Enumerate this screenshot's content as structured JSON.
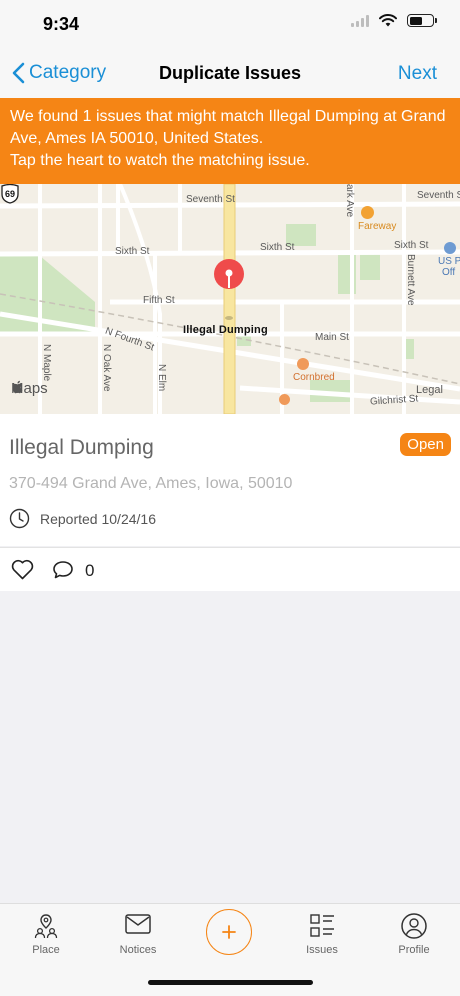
{
  "status_bar": {
    "time": "9:34"
  },
  "nav": {
    "back_label": "Category",
    "title": "Duplicate Issues",
    "next_label": "Next"
  },
  "banner": {
    "line1": "We found 1 issues that might match Illegal Dumping at Grand Ave, Ames IA 50010, United States.",
    "line2": "Tap the heart to watch the matching issue."
  },
  "map": {
    "pin_label": "Illegal Dumping",
    "logo_text": "Maps",
    "highway_number": "69",
    "streets": {
      "seventh_left": "Seventh St",
      "seventh_right": "Seventh St",
      "sixth_left": "Sixth St",
      "sixth_mid": "Sixth St",
      "sixth_right": "Sixth St",
      "fifth": "Fifth St",
      "main": "Main St",
      "n_fourth": "N Fourth St",
      "n_maple": "N Maple",
      "n_oak": "N Oak Ave",
      "n_elm": "N Elm",
      "burnett": "Burnett Ave",
      "park": "ark Ave",
      "gilchrist": "Gilchrist St",
      "legal": "Legal"
    },
    "pois": {
      "fareway": "Fareway",
      "cornbred": "Cornbred",
      "us_post": "US P",
      "us_post_2": "Off"
    }
  },
  "issue": {
    "title": "Illegal Dumping",
    "status": "Open",
    "address": "370-494 Grand Ave, Ames, Iowa, 50010",
    "reported": "Reported 10/24/16",
    "comment_count": "0"
  },
  "tabs": [
    {
      "label": "Place",
      "icon": "place-icon"
    },
    {
      "label": "Notices",
      "icon": "envelope-icon"
    },
    {
      "label": "Issues",
      "icon": "issues-list-icon"
    },
    {
      "label": "Profile",
      "icon": "profile-icon"
    }
  ],
  "colors": {
    "accent": "#f58515",
    "link": "#1a8fd6",
    "map_bg": "#f3efe6",
    "park": "#cfe5c0"
  }
}
